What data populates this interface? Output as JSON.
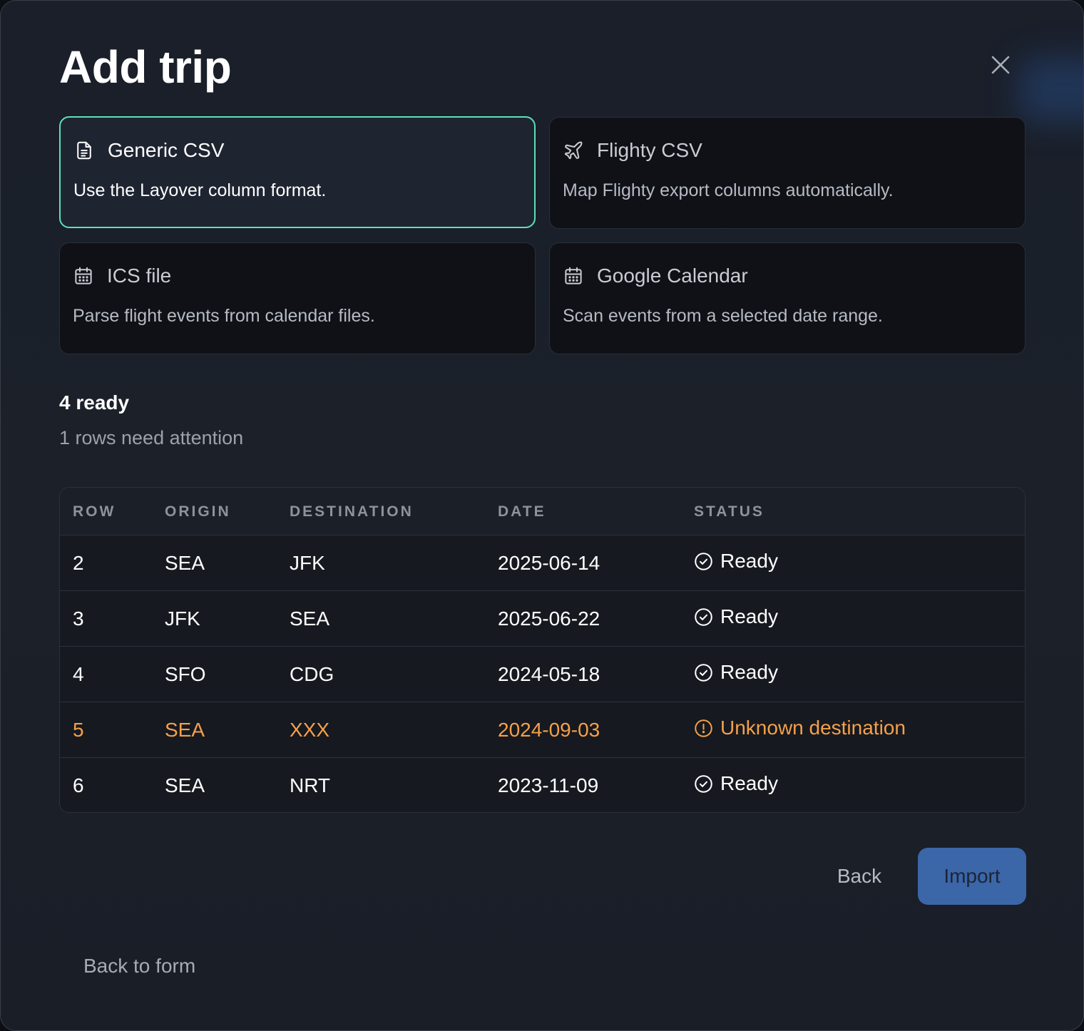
{
  "dialog": {
    "title": "Add trip",
    "close_label": "Close"
  },
  "sources": [
    {
      "name": "Generic CSV",
      "description": "Use the Layover column format.",
      "icon": "file-text-icon",
      "selected": true
    },
    {
      "name": "Flighty CSV",
      "description": "Map Flighty export columns automatically.",
      "icon": "plane-icon",
      "selected": false
    },
    {
      "name": "ICS file",
      "description": "Parse flight events from calendar files.",
      "icon": "calendar-icon",
      "selected": false
    },
    {
      "name": "Google Calendar",
      "description": "Scan events from a selected date range.",
      "icon": "calendar-icon",
      "selected": false
    }
  ],
  "summary": {
    "ready": "4 ready",
    "attention": "1 rows need attention"
  },
  "table": {
    "columns": [
      "ROW",
      "ORIGIN",
      "DESTINATION",
      "DATE",
      "STATUS"
    ],
    "rows": [
      {
        "row": "2",
        "origin": "SEA",
        "destination": "JFK",
        "date": "2025-06-14",
        "status": "Ready",
        "state": "ok"
      },
      {
        "row": "3",
        "origin": "JFK",
        "destination": "SEA",
        "date": "2025-06-22",
        "status": "Ready",
        "state": "ok"
      },
      {
        "row": "4",
        "origin": "SFO",
        "destination": "CDG",
        "date": "2024-05-18",
        "status": "Ready",
        "state": "ok"
      },
      {
        "row": "5",
        "origin": "SEA",
        "destination": "XXX",
        "date": "2024-09-03",
        "status": "Unknown destination",
        "state": "warn"
      },
      {
        "row": "6",
        "origin": "SEA",
        "destination": "NRT",
        "date": "2023-11-09",
        "status": "Ready",
        "state": "ok"
      }
    ]
  },
  "actions": {
    "back": "Back",
    "import": "Import",
    "back_to_form": "Back to form"
  },
  "colors": {
    "accent_border": "#5ee0b5",
    "warning": "#f5a04a",
    "primary_button": "#3b66a8"
  }
}
